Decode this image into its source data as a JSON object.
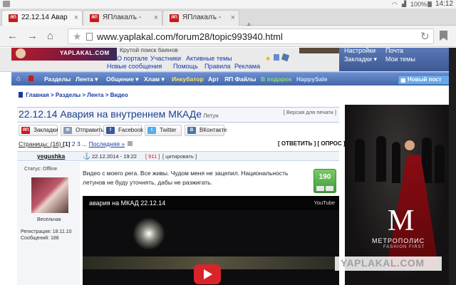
{
  "status_bar": {
    "battery": "100%",
    "time": "14:12"
  },
  "tabs": [
    {
      "label": "22.12.14 Авар",
      "favicon": "ЯП",
      "active": true
    },
    {
      "label": "ЯПлакалъ -",
      "favicon": "ЯП",
      "active": false
    },
    {
      "label": "ЯПлакалъ -",
      "favicon": "ЯП",
      "active": false
    }
  ],
  "browser": {
    "url": "www.yaplakal.com/forum28/topic993940.html",
    "icons": [
      "back-icon",
      "forward-icon",
      "home-icon",
      "bookmark-star-icon",
      "page-icon",
      "reload-icon",
      "bookmarks-icon"
    ]
  },
  "site_header": {
    "logo_text": "YAPLAKAL.COM",
    "tagline": "Крутой поиск баянов",
    "links_row1": [
      "О портале",
      "Участники",
      "Активные темы"
    ],
    "links_row2": [
      "Новые сообщения",
      "Помощь",
      "Правила",
      "Реклама"
    ],
    "user_menu": {
      "settings": "Настройки",
      "mail": "Почта",
      "bookmarks": "Закладки ▾",
      "my_topics": "Мои темы"
    }
  },
  "nav": {
    "items": [
      {
        "label": "Разделы",
        "color": "#ffffff"
      },
      {
        "label": "Лента ▾",
        "color": "#ffffff"
      },
      {
        "label": "Общение ▾",
        "color": "#ffffff"
      },
      {
        "label": "Хлам ▾",
        "color": "#ffffff"
      },
      {
        "label": "Инкубатор",
        "color": "#ffe66b"
      },
      {
        "label": "Арт",
        "color": "#ffffff"
      },
      {
        "label": "ЯП Файлы",
        "color": "#ffffff"
      },
      {
        "label": "В подарок",
        "color": "#8ce06a"
      },
      {
        "label": "HappySale",
        "color": "#cfe0ff"
      }
    ],
    "new_post": "Новый пост"
  },
  "breadcrumb": [
    "Главная",
    "Разделы",
    "Лента",
    "Видео"
  ],
  "topic": {
    "title": "22.12.14 Авария на внутреннем МКАДе",
    "subtitle": "Летун",
    "print_version": "[ Версия для печати ]"
  },
  "share_buttons": [
    {
      "label": "Закладки",
      "icon": "yaplakal-icon",
      "color": "#c8191b"
    },
    {
      "label": "Отправить",
      "icon": "mail-icon",
      "color": "#8a9bb5"
    },
    {
      "label": "Facebook",
      "icon": "facebook-icon",
      "color": "#3b5998"
    },
    {
      "label": "Twitter",
      "icon": "twitter-icon",
      "color": "#55acee"
    },
    {
      "label": "ВКонтакте",
      "icon": "vk-icon",
      "color": "#4c75a3"
    }
  ],
  "pagination": {
    "prefix": "Страницы: (16) ",
    "current": "[1]",
    "pages": [
      "2",
      "3"
    ],
    "ellipsis": "...",
    "last": "Последняя »",
    "reply": "[ ОТВЕТИТЬ ]",
    "poll": "[ ОПРОС ]"
  },
  "post": {
    "author": "yegushka",
    "date": "22.12.2014 - 19:22",
    "post_number": "[ 911 ]",
    "quote": "[ цитировать ]",
    "status": "Статус: Offline",
    "user_title": "Весельчак",
    "registered": "Регистрация: 18.11.10",
    "messages": "Сообщений: 188",
    "text": "Видео с моего рега. Все живы. Чудом меня не зацепил. Национальность летунов не буду уточнять, дабы не разжигать.",
    "rating": "190"
  },
  "video": {
    "title": "авария на МКАД 22.12.14",
    "provider": "YouTube"
  },
  "ad": {
    "brand_letter": "M",
    "brand": "МЕТРОПОЛИС",
    "tagline": "FASHION FIRST",
    "watermark": "YAPLAKAL.COM"
  }
}
